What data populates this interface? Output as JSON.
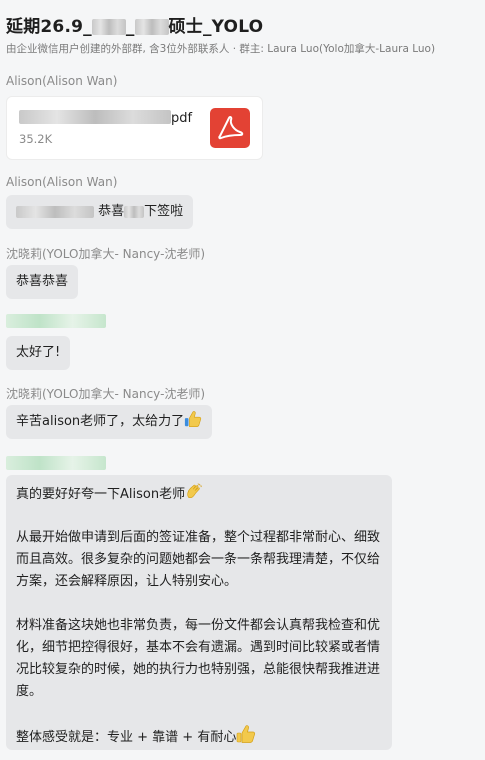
{
  "header": {
    "title_prefix": "延期26.9_",
    "title_mid": "_",
    "title_suffix": "硕士_YOLO",
    "subtitle": "由企业微信用户创建的外部群, 含3位外部联系人 · 群主: Laura Luo(Yolo加拿大-Laura Luo)"
  },
  "messages": {
    "m1": {
      "sender": "Alison(Alison Wan)",
      "file_ext": "pdf",
      "file_size": "35.2K",
      "icon": "pdf-icon"
    },
    "m2": {
      "sender": "Alison(Alison Wan)",
      "text_a": "恭喜",
      "text_b": "下签啦"
    },
    "m3": {
      "sender": "沈晓莉(YOLO加拿大- Nancy-沈老师)",
      "text": "恭喜恭喜"
    },
    "m4": {
      "text": "太好了!"
    },
    "m5": {
      "sender": "沈晓莉(YOLO加拿大- Nancy-沈老师)",
      "text": "辛苦alison老师了，太给力了",
      "icon": "thumbs-up-icon"
    },
    "m6": {
      "line1": "真的要好好夸一下Alison老师",
      "line1_icon": "clapping-hands-icon",
      "para1": "从最开始做申请到后面的签证准备，整个过程都非常耐心、细致而且高效。很多复杂的问题她都会一条一条帮我理清楚，不仅给方案，还会解释原因，让人特别安心。",
      "para2": "材料准备这块她也非常负责，每一份文件都会认真帮我检查和优化，细节把控得很好，基本不会有遗漏。遇到时间比较紧或者情况比较复杂的时候，她的执行力也特别强，总能很快帮我推进进度。",
      "para3": "整体感受就是：专业 + 靠谱 + 有耐心",
      "para3_icon": "thumbs-up-icon"
    }
  }
}
